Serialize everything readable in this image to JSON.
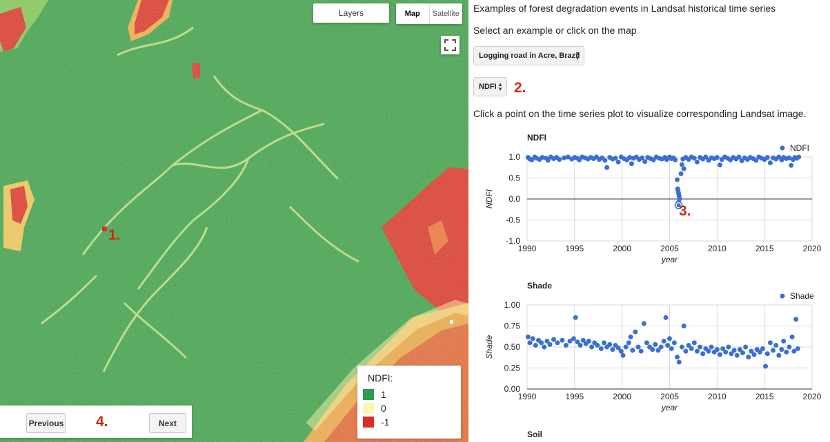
{
  "map": {
    "layers_label": "Layers",
    "map_type": {
      "map_label": "Map",
      "satellite_label": "Satellite",
      "selected": "Map"
    },
    "legend": {
      "title": "NDFI:",
      "items": [
        {
          "label": "1",
          "color": "#2e9b4e"
        },
        {
          "label": "0",
          "color": "#fbf7b0"
        },
        {
          "label": "-1",
          "color": "#d6302b"
        }
      ]
    },
    "nav": {
      "previous_label": "Previous",
      "next_label": "Next"
    },
    "annotations": {
      "a1": "1.",
      "a4": "4."
    },
    "colors": {
      "forest": "#3a9a4c",
      "degraded": "#d6302b",
      "road": "#c9df8a"
    }
  },
  "panel": {
    "title": "Examples of forest degradation events in Landsat historical time series",
    "select_prompt": "Select an example or click on the map",
    "example_select": {
      "value": "Logging road in Acre, Brazil"
    },
    "index_select": {
      "value": "NDFI"
    },
    "annotation_2": "2.",
    "instructions": "Click a point on the time series plot to visualize corresponding Landsat image.",
    "annotation_3": "3.",
    "next_chart_title": "Soil"
  },
  "chart_data": [
    {
      "type": "scatter",
      "title": "NDFI",
      "xlabel": "year",
      "ylabel": "NDFI",
      "xlim": [
        1990,
        2020
      ],
      "ylim": [
        -1.0,
        1.0
      ],
      "x_ticks": [
        "1990",
        "1995",
        "2000",
        "2005",
        "2010",
        "2015",
        "2020"
      ],
      "y_ticks": [
        "1.0",
        "0.5",
        "0.0",
        "-0.5",
        "-1.0"
      ],
      "legend": {
        "position": "top-right"
      },
      "series": [
        {
          "name": "NDFI",
          "color": "#3b6fd4",
          "points": [
            [
              1990.1,
              0.99
            ],
            [
              1990.3,
              0.95
            ],
            [
              1990.5,
              0.93
            ],
            [
              1990.8,
              1.0
            ],
            [
              1991.0,
              0.97
            ],
            [
              1991.3,
              0.94
            ],
            [
              1991.6,
              0.99
            ],
            [
              1992.0,
              0.97
            ],
            [
              1992.2,
              0.92
            ],
            [
              1992.5,
              1.0
            ],
            [
              1992.8,
              0.96
            ],
            [
              1993.1,
              0.99
            ],
            [
              1993.4,
              0.94
            ],
            [
              1993.9,
              0.98
            ],
            [
              1994.3,
              1.0
            ],
            [
              1994.7,
              0.95
            ],
            [
              1995.0,
              0.99
            ],
            [
              1995.3,
              0.97
            ],
            [
              1995.5,
              0.93
            ],
            [
              1995.8,
              1.0
            ],
            [
              1996.1,
              0.98
            ],
            [
              1996.4,
              0.95
            ],
            [
              1996.7,
              0.99
            ],
            [
              1997.0,
              0.96
            ],
            [
              1997.3,
              1.0
            ],
            [
              1997.6,
              0.94
            ],
            [
              1997.9,
              0.98
            ],
            [
              1998.2,
              0.92
            ],
            [
              1998.4,
              0.75
            ],
            [
              1998.7,
              0.99
            ],
            [
              1999.0,
              0.95
            ],
            [
              1999.3,
              0.97
            ],
            [
              1999.6,
              0.88
            ],
            [
              1999.9,
              1.0
            ],
            [
              2000.2,
              0.96
            ],
            [
              2000.5,
              0.93
            ],
            [
              2000.8,
              0.99
            ],
            [
              2001.0,
              0.84
            ],
            [
              2001.2,
              0.97
            ],
            [
              2001.5,
              1.0
            ],
            [
              2001.8,
              0.94
            ],
            [
              2002.1,
              0.98
            ],
            [
              2002.4,
              0.89
            ],
            [
              2002.7,
              0.99
            ],
            [
              2003.0,
              0.96
            ],
            [
              2003.3,
              0.93
            ],
            [
              2003.6,
              1.0
            ],
            [
              2003.9,
              0.97
            ],
            [
              2004.2,
              0.95
            ],
            [
              2004.5,
              0.99
            ],
            [
              2004.7,
              0.94
            ],
            [
              2005.0,
              1.0
            ],
            [
              2005.2,
              0.96
            ],
            [
              2005.4,
              0.98
            ],
            [
              2005.6,
              0.93
            ],
            [
              2005.8,
              0.46
            ],
            [
              2005.85,
              0.24
            ],
            [
              2005.9,
              0.19
            ],
            [
              2005.95,
              0.13
            ],
            [
              2006.0,
              0.07
            ],
            [
              2006.05,
              0.0
            ],
            [
              2005.95,
              -0.08
            ],
            [
              2006.02,
              -0.13
            ],
            [
              2006.2,
              0.6
            ],
            [
              2006.3,
              0.82
            ],
            [
              2006.4,
              0.95
            ],
            [
              2006.5,
              0.72
            ],
            [
              2006.7,
              0.99
            ],
            [
              2007.0,
              0.94
            ],
            [
              2007.3,
              1.0
            ],
            [
              2007.6,
              0.97
            ],
            [
              2007.9,
              0.88
            ],
            [
              2008.2,
              0.99
            ],
            [
              2008.5,
              0.95
            ],
            [
              2008.8,
              1.0
            ],
            [
              2009.1,
              0.92
            ],
            [
              2009.4,
              0.98
            ],
            [
              2009.7,
              0.96
            ],
            [
              2010.0,
              0.99
            ],
            [
              2010.3,
              0.81
            ],
            [
              2010.5,
              0.94
            ],
            [
              2010.8,
              1.0
            ],
            [
              2011.1,
              0.97
            ],
            [
              2011.4,
              0.93
            ],
            [
              2011.7,
              0.99
            ],
            [
              2012.0,
              0.95
            ],
            [
              2012.3,
              1.0
            ],
            [
              2012.6,
              0.91
            ],
            [
              2012.9,
              0.98
            ],
            [
              2013.2,
              0.94
            ],
            [
              2013.5,
              0.99
            ],
            [
              2013.8,
              0.96
            ],
            [
              2014.1,
              0.92
            ],
            [
              2014.4,
              1.0
            ],
            [
              2014.7,
              0.97
            ],
            [
              2015.0,
              0.94
            ],
            [
              2015.3,
              0.99
            ],
            [
              2015.6,
              0.86
            ],
            [
              2015.9,
              0.98
            ],
            [
              2016.2,
              0.95
            ],
            [
              2016.5,
              1.0
            ],
            [
              2016.8,
              0.93
            ],
            [
              2017.0,
              0.99
            ],
            [
              2017.3,
              0.96
            ],
            [
              2017.6,
              0.98
            ],
            [
              2017.8,
              0.8
            ],
            [
              2018.0,
              0.94
            ],
            [
              2018.2,
              0.99
            ],
            [
              2018.4,
              0.97
            ],
            [
              2018.6,
              1.0
            ]
          ],
          "selected_point": [
            2005.95,
            -0.15
          ]
        }
      ]
    },
    {
      "type": "scatter",
      "title": "Shade",
      "xlabel": "year",
      "ylabel": "Shade",
      "xlim": [
        1990,
        2020
      ],
      "ylim": [
        0.0,
        1.0
      ],
      "x_ticks": [
        "1990",
        "1995",
        "2000",
        "2005",
        "2010",
        "2015",
        "2020"
      ],
      "y_ticks": [
        "1.00",
        "0.75",
        "0.50",
        "0.25",
        "0.00"
      ],
      "legend": {
        "position": "top-right"
      },
      "series": [
        {
          "name": "Shade",
          "color": "#3b6fd4",
          "points": [
            [
              1990.1,
              0.62
            ],
            [
              1990.3,
              0.55
            ],
            [
              1990.6,
              0.6
            ],
            [
              1990.9,
              0.52
            ],
            [
              1991.2,
              0.58
            ],
            [
              1991.5,
              0.55
            ],
            [
              1991.8,
              0.5
            ],
            [
              1992.1,
              0.57
            ],
            [
              1992.4,
              0.53
            ],
            [
              1992.8,
              0.59
            ],
            [
              1993.2,
              0.55
            ],
            [
              1993.7,
              0.58
            ],
            [
              1994.1,
              0.52
            ],
            [
              1994.5,
              0.57
            ],
            [
              1994.9,
              0.6
            ],
            [
              1995.1,
              0.85
            ],
            [
              1995.3,
              0.56
            ],
            [
              1995.6,
              0.52
            ],
            [
              1995.9,
              0.58
            ],
            [
              1996.2,
              0.54
            ],
            [
              1996.5,
              0.57
            ],
            [
              1996.8,
              0.5
            ],
            [
              1997.1,
              0.55
            ],
            [
              1997.4,
              0.52
            ],
            [
              1997.8,
              0.48
            ],
            [
              1998.1,
              0.55
            ],
            [
              1998.4,
              0.5
            ],
            [
              1998.7,
              0.53
            ],
            [
              1999.0,
              0.47
            ],
            [
              1999.3,
              0.52
            ],
            [
              1999.6,
              0.49
            ],
            [
              1999.9,
              0.45
            ],
            [
              2000.1,
              0.4
            ],
            [
              2000.4,
              0.5
            ],
            [
              2000.7,
              0.55
            ],
            [
              2000.9,
              0.62
            ],
            [
              2001.1,
              0.46
            ],
            [
              2001.4,
              0.68
            ],
            [
              2001.7,
              0.5
            ],
            [
              2002.0,
              0.45
            ],
            [
              2002.3,
              0.78
            ],
            [
              2002.6,
              0.55
            ],
            [
              2002.9,
              0.5
            ],
            [
              2003.2,
              0.47
            ],
            [
              2003.5,
              0.53
            ],
            [
              2003.8,
              0.46
            ],
            [
              2004.1,
              0.5
            ],
            [
              2004.4,
              0.57
            ],
            [
              2004.6,
              0.85
            ],
            [
              2004.8,
              0.52
            ],
            [
              2005.0,
              0.6
            ],
            [
              2005.2,
              0.48
            ],
            [
              2005.5,
              0.55
            ],
            [
              2005.8,
              0.38
            ],
            [
              2006.0,
              0.32
            ],
            [
              2006.3,
              0.5
            ],
            [
              2006.5,
              0.75
            ],
            [
              2006.7,
              0.45
            ],
            [
              2007.0,
              0.52
            ],
            [
              2007.3,
              0.48
            ],
            [
              2007.6,
              0.55
            ],
            [
              2007.9,
              0.45
            ],
            [
              2008.2,
              0.5
            ],
            [
              2008.5,
              0.42
            ],
            [
              2008.8,
              0.48
            ],
            [
              2009.1,
              0.45
            ],
            [
              2009.4,
              0.5
            ],
            [
              2009.7,
              0.44
            ],
            [
              2010.0,
              0.47
            ],
            [
              2010.3,
              0.41
            ],
            [
              2010.6,
              0.48
            ],
            [
              2010.9,
              0.44
            ],
            [
              2011.2,
              0.5
            ],
            [
              2011.5,
              0.42
            ],
            [
              2011.8,
              0.46
            ],
            [
              2012.1,
              0.4
            ],
            [
              2012.4,
              0.47
            ],
            [
              2012.7,
              0.43
            ],
            [
              2013.0,
              0.5
            ],
            [
              2013.3,
              0.38
            ],
            [
              2013.6,
              0.45
            ],
            [
              2013.9,
              0.41
            ],
            [
              2014.2,
              0.47
            ],
            [
              2014.5,
              0.44
            ],
            [
              2014.8,
              0.48
            ],
            [
              2015.1,
              0.27
            ],
            [
              2015.3,
              0.42
            ],
            [
              2015.6,
              0.55
            ],
            [
              2015.9,
              0.46
            ],
            [
              2016.2,
              0.52
            ],
            [
              2016.5,
              0.4
            ],
            [
              2016.8,
              0.47
            ],
            [
              2017.0,
              0.57
            ],
            [
              2017.3,
              0.44
            ],
            [
              2017.6,
              0.5
            ],
            [
              2017.9,
              0.62
            ],
            [
              2018.1,
              0.45
            ],
            [
              2018.3,
              0.83
            ],
            [
              2018.5,
              0.48
            ]
          ]
        }
      ]
    }
  ]
}
